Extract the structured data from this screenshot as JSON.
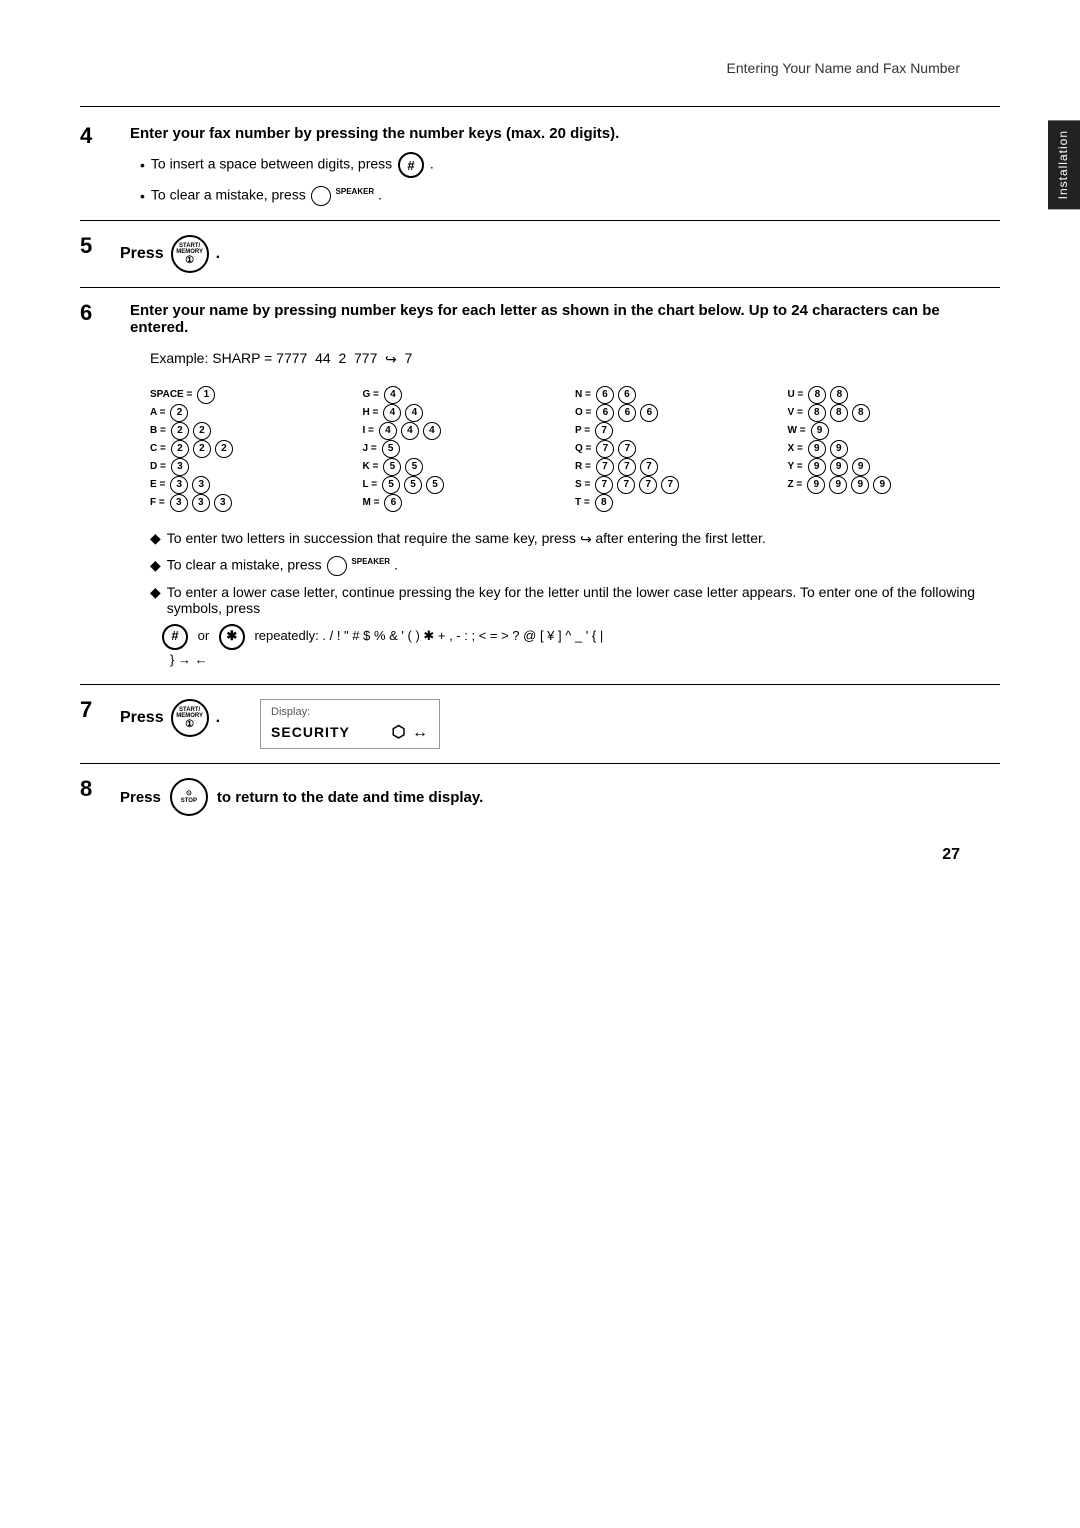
{
  "page": {
    "header": "Entering Your Name and Fax Number",
    "side_tab": "Installation",
    "page_number": "27",
    "step4": {
      "number": "4",
      "title": "Enter your fax number by pressing the number keys (max. 20 digits).",
      "bullets": [
        "To insert a space between digits, press # .",
        "To clear a mistake, press SPEAKER ."
      ]
    },
    "step5": {
      "number": "5",
      "press_label": "Press",
      "button": "START/MEMORY"
    },
    "step6": {
      "number": "6",
      "title": "Enter your name by pressing number keys for each letter as shown in the chart below. Up to 24 characters can be entered.",
      "example": "Example: SHARP = 7777  44  2  777",
      "example_suffix": "7",
      "chars": [
        {
          "label": "SPACE = ",
          "keys": [
            "1"
          ]
        },
        {
          "label": "A = ",
          "keys": [
            "2"
          ]
        },
        {
          "label": "B = ",
          "keys": [
            "2",
            "2"
          ]
        },
        {
          "label": "C = ",
          "keys": [
            "2",
            "2",
            "2"
          ]
        },
        {
          "label": "D = ",
          "keys": [
            "3"
          ]
        },
        {
          "label": "E = ",
          "keys": [
            "3",
            "3"
          ]
        },
        {
          "label": "F = ",
          "keys": [
            "3",
            "3",
            "3"
          ]
        },
        {
          "label": "G = ",
          "keys": [
            "4"
          ]
        },
        {
          "label": "H = ",
          "keys": [
            "4",
            "4"
          ]
        },
        {
          "label": "I = ",
          "keys": [
            "4",
            "4",
            "4"
          ]
        },
        {
          "label": "J = ",
          "keys": [
            "5"
          ]
        },
        {
          "label": "K = ",
          "keys": [
            "5",
            "5"
          ]
        },
        {
          "label": "L = ",
          "keys": [
            "5",
            "5",
            "5"
          ]
        },
        {
          "label": "M = ",
          "keys": [
            "6"
          ]
        },
        {
          "label": "N = ",
          "keys": [
            "6",
            "6"
          ]
        },
        {
          "label": "O = ",
          "keys": [
            "6",
            "6",
            "6"
          ]
        },
        {
          "label": "P = ",
          "keys": [
            "7"
          ]
        },
        {
          "label": "Q = ",
          "keys": [
            "7",
            "7"
          ]
        },
        {
          "label": "R = ",
          "keys": [
            "7",
            "7",
            "7"
          ]
        },
        {
          "label": "S = ",
          "keys": [
            "7",
            "7",
            "7",
            "7"
          ]
        },
        {
          "label": "T = ",
          "keys": [
            "8"
          ]
        },
        {
          "label": "U = ",
          "keys": [
            "8",
            "8"
          ]
        },
        {
          "label": "V = ",
          "keys": [
            "8",
            "8",
            "8"
          ]
        },
        {
          "label": "W = ",
          "keys": [
            "9"
          ]
        },
        {
          "label": "X = ",
          "keys": [
            "9",
            "9"
          ]
        },
        {
          "label": "Y = ",
          "keys": [
            "9",
            "9",
            "9"
          ]
        },
        {
          "label": "Z = ",
          "keys": [
            "9",
            "9",
            "9",
            "9"
          ]
        }
      ],
      "diamonds": [
        "To enter two letters in succession that require the same key, press after entering the first letter.",
        "To clear a mistake, press SPEAKER .",
        "To enter a lower case letter, continue pressing the key for the letter until the lower case letter appears. To enter one of the following symbols, press"
      ],
      "symbols_line": "or  repeatedly: . / ! \" # $ % & ' ( ) ✱ + , - : ; < = > ? @ [ ¥ ] ^ _ ' { | } → ←"
    },
    "step7": {
      "number": "7",
      "press_label": "Press",
      "button": "START/MEMORY",
      "display_label": "Display:",
      "display_value": "SECURITY",
      "display_arrow": "⬡"
    },
    "step8": {
      "number": "8",
      "press_label": "Press",
      "button": "STOP",
      "suffix": "to return to the date and time display."
    }
  }
}
